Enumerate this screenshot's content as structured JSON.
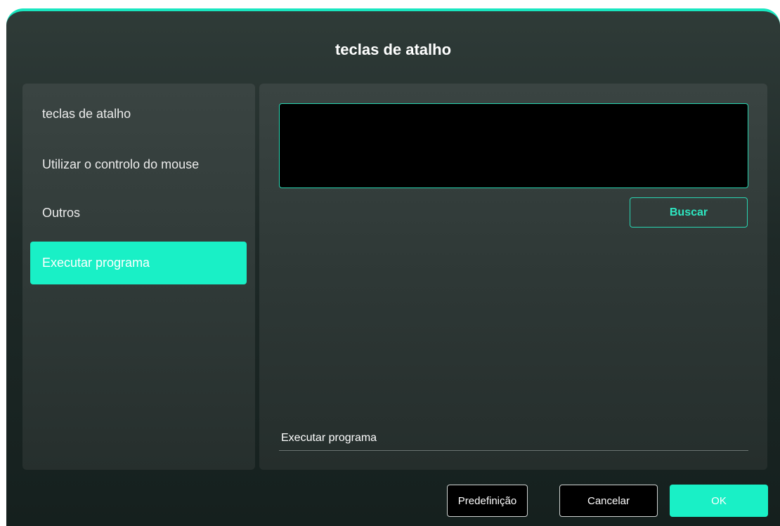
{
  "dialog": {
    "title": "teclas de atalho"
  },
  "sidebar": {
    "items": [
      {
        "label": "teclas de atalho"
      },
      {
        "label": "Utilizar o controlo do mouse"
      },
      {
        "label": "Outros"
      },
      {
        "label": "Executar programa",
        "active": true
      }
    ]
  },
  "content": {
    "program_path_value": "",
    "buscar_label": "Buscar",
    "field_label": "Executar programa"
  },
  "footer": {
    "default_label": "Predefinição",
    "cancel_label": "Cancelar",
    "ok_label": "OK"
  },
  "colors": {
    "accent": "#19f0c6",
    "accent_border": "#2ad6b2"
  }
}
